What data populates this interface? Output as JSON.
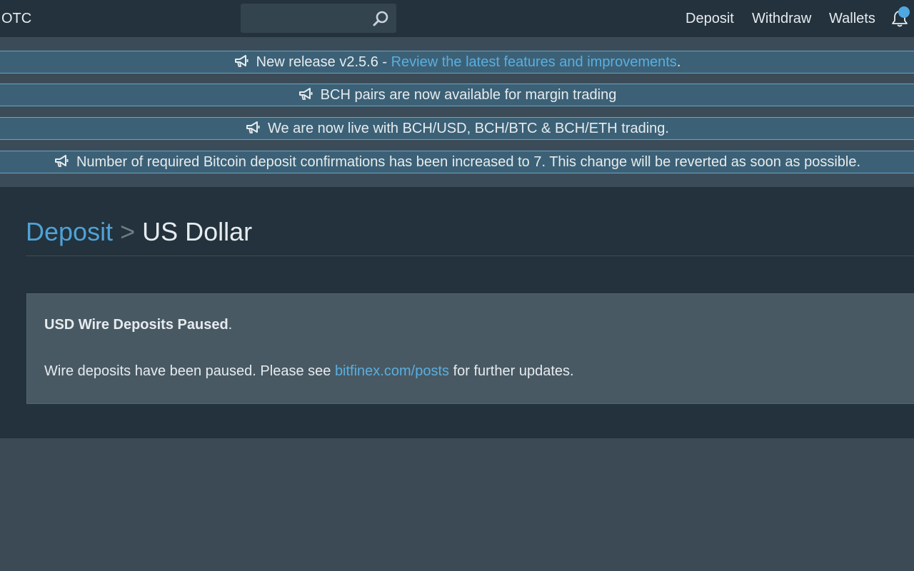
{
  "header": {
    "brand": "OTC",
    "search_placeholder": "",
    "nav": {
      "deposit": "Deposit",
      "withdraw": "Withdraw",
      "wallets": "Wallets"
    },
    "icons": {
      "search": "search-icon",
      "notifications": "bell-icon"
    }
  },
  "announcements": [
    {
      "text": "New release v2.5.6 - ",
      "link": "Review the latest features and improvements",
      "suffix": "."
    },
    {
      "text": "BCH pairs are now available for margin trading"
    },
    {
      "text": "We are now live with BCH/USD, BCH/BTC & BCH/ETH trading."
    },
    {
      "text": "Number of required Bitcoin deposit confirmations has been increased to 7. This change will be reverted as soon as possible."
    }
  ],
  "breadcrumb": {
    "parent": "Deposit",
    "separator": ">",
    "current": "US Dollar"
  },
  "notice": {
    "title": "USD Wire Deposits Paused",
    "title_suffix": ".",
    "body_prefix": "Wire deposits have been paused. Please see ",
    "body_link": "bitfinex.com/posts",
    "body_suffix": " for further updates."
  },
  "colors": {
    "topbar": "#23323c",
    "announcement_bg": "#3c6176",
    "link": "#5aaee0",
    "notification_dot": "#4fa8e0"
  }
}
